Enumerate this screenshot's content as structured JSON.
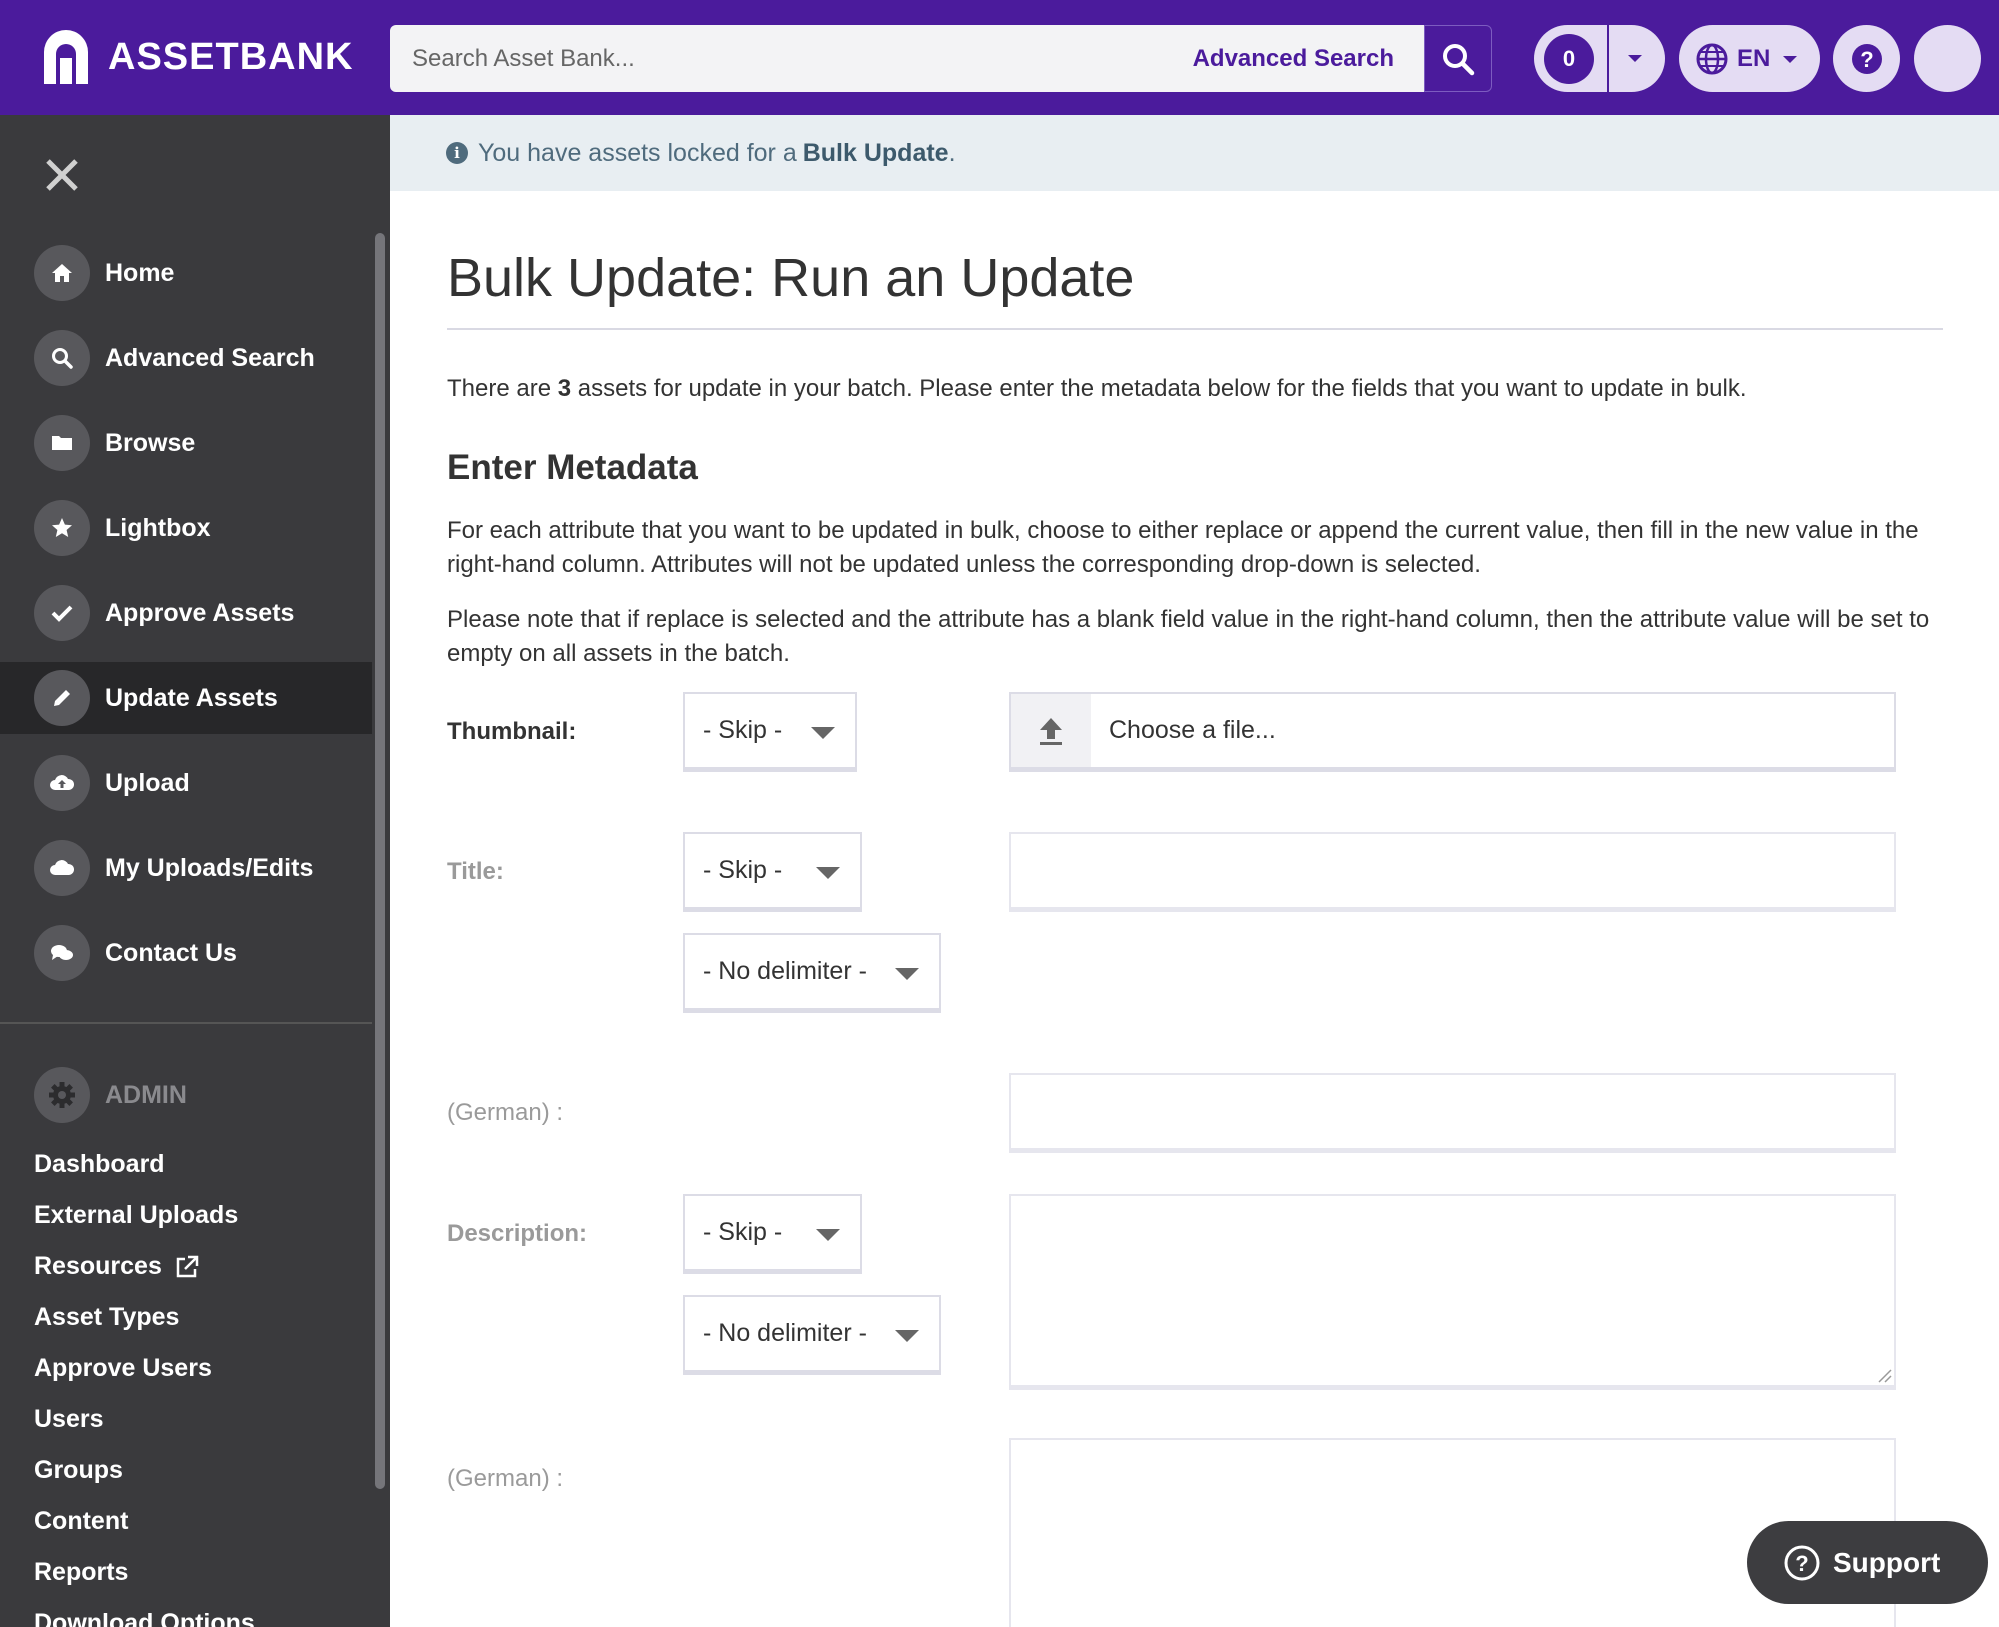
{
  "brand": {
    "name": "ASSETBANK",
    "accent": "#4b1b9c"
  },
  "search": {
    "placeholder": "Search Asset Bank...",
    "advanced_label": "Advanced Search",
    "icon": "search-icon"
  },
  "header": {
    "cart_count": "0",
    "language": "EN"
  },
  "sidebar": {
    "close_icon": "close-icon",
    "items": [
      {
        "label": "Home",
        "icon": "home-icon"
      },
      {
        "label": "Advanced Search",
        "icon": "search-icon"
      },
      {
        "label": "Browse",
        "icon": "folder-icon"
      },
      {
        "label": "Lightbox",
        "icon": "star-icon"
      },
      {
        "label": "Approve Assets",
        "icon": "check-icon"
      },
      {
        "label": "Update Assets",
        "icon": "pencil-icon",
        "active": true
      },
      {
        "label": "Upload",
        "icon": "cloud-upload-icon"
      },
      {
        "label": "My Uploads/Edits",
        "icon": "cloud-icon"
      },
      {
        "label": "Contact Us",
        "icon": "chat-icon"
      }
    ],
    "admin": {
      "label": "ADMIN",
      "icon": "gear-icon",
      "links": [
        "Dashboard",
        "External Uploads",
        "Resources",
        "Asset Types",
        "Approve Users",
        "Users",
        "Groups",
        "Content",
        "Reports",
        "Download Options"
      ]
    }
  },
  "notice": {
    "text": "You have assets locked for a",
    "link": "Bulk Update",
    "end": "."
  },
  "page": {
    "title": "Bulk Update: Run an Update",
    "intro_pre": "There are",
    "intro_count": "3",
    "intro_post": "assets for update in your batch. Please enter the metadata below for the fields that you want to update in bulk.",
    "section_title": "Enter Metadata",
    "para1": "For each attribute that you want to be updated in bulk, choose to either replace or append the current value, then fill in the new value in the right-hand column. Attributes will not be updated unless the corresponding drop-down is selected.",
    "para2": "Please note that if replace is selected and the attribute has a blank field value in the right-hand column, then the attribute value will be set to empty on all assets in the batch."
  },
  "form": {
    "thumbnail_label": "Thumbnail:",
    "title_label": "Title:",
    "german_label": "(German) :",
    "description_label": "Description:",
    "skip_option": "- Skip -",
    "delimiter_option": "- No delimiter -",
    "file_placeholder": "Choose a file...",
    "title_value": "",
    "title_german_value": "",
    "description_value": "",
    "description_german_value": ""
  },
  "support": {
    "label": "Support"
  }
}
